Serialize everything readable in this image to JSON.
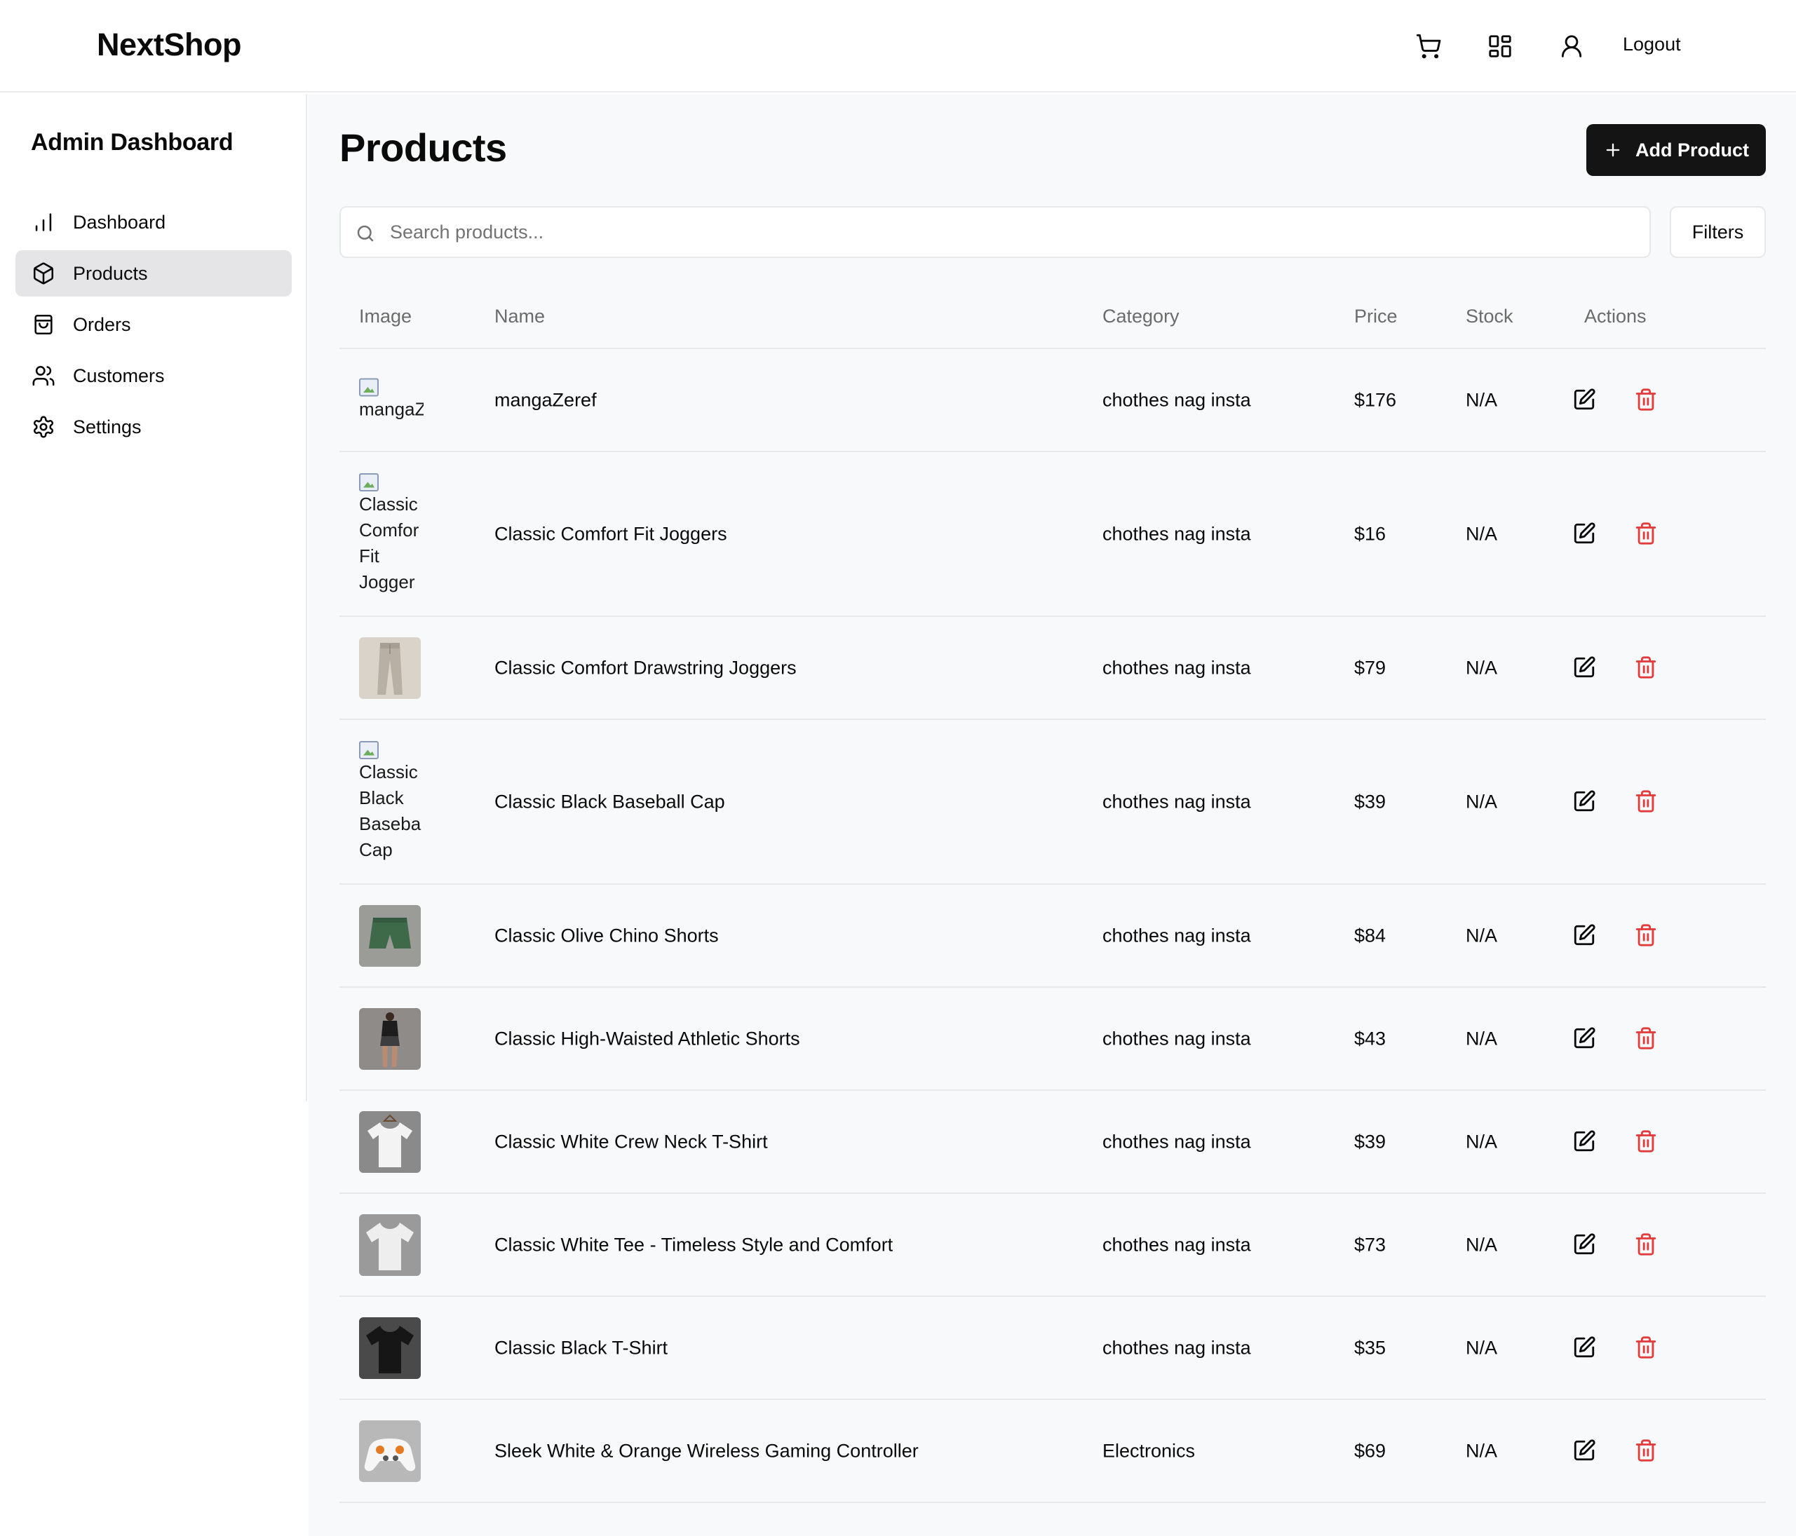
{
  "header": {
    "brand": "NextShop",
    "icons": [
      "cart-icon",
      "dashboard-grid-icon",
      "user-icon"
    ],
    "logout_label": "Logout"
  },
  "sidebar": {
    "title": "Admin Dashboard",
    "items": [
      {
        "label": "Dashboard",
        "icon": "bar-chart-icon",
        "active": false
      },
      {
        "label": "Products",
        "icon": "package-icon",
        "active": true
      },
      {
        "label": "Orders",
        "icon": "shopping-bag-icon",
        "active": false
      },
      {
        "label": "Customers",
        "icon": "users-icon",
        "active": false
      },
      {
        "label": "Settings",
        "icon": "gear-icon",
        "active": false
      }
    ]
  },
  "main": {
    "title": "Products",
    "add_button_label": "Add Product",
    "search_placeholder": "Search products...",
    "search_value": "",
    "filters_label": "Filters",
    "columns": [
      "Image",
      "Name",
      "Category",
      "Price",
      "Stock",
      "Actions"
    ],
    "rows": [
      {
        "image_alt": "mangaZ",
        "image_broken": true,
        "name": "mangaZeref",
        "category": "chothes nag insta",
        "price": "$176",
        "stock": "N/A"
      },
      {
        "image_alt": "Classic\nComfor\nFit\nJogger",
        "image_broken": true,
        "name": "Classic Comfort Fit Joggers",
        "category": "chothes nag insta",
        "price": "$16",
        "stock": "N/A"
      },
      {
        "image_alt": "",
        "image_broken": false,
        "thumb": "joggers-beige",
        "name": "Classic Comfort Drawstring Joggers",
        "category": "chothes nag insta",
        "price": "$79",
        "stock": "N/A"
      },
      {
        "image_alt": "Classic\nBlack\nBaseba\nCap",
        "image_broken": true,
        "name": "Classic Black Baseball Cap",
        "category": "chothes nag insta",
        "price": "$39",
        "stock": "N/A"
      },
      {
        "image_alt": "",
        "image_broken": false,
        "thumb": "shorts-olive",
        "name": "Classic Olive Chino Shorts",
        "category": "chothes nag insta",
        "price": "$84",
        "stock": "N/A"
      },
      {
        "image_alt": "",
        "image_broken": false,
        "thumb": "athletic-shorts",
        "name": "Classic High-Waisted Athletic Shorts",
        "category": "chothes nag insta",
        "price": "$43",
        "stock": "N/A"
      },
      {
        "image_alt": "",
        "image_broken": false,
        "thumb": "tshirt-white-hanger",
        "name": "Classic White Crew Neck T-Shirt",
        "category": "chothes nag insta",
        "price": "$39",
        "stock": "N/A"
      },
      {
        "image_alt": "",
        "image_broken": false,
        "thumb": "tshirt-white",
        "name": "Classic White Tee - Timeless Style and Comfort",
        "category": "chothes nag insta",
        "price": "$73",
        "stock": "N/A"
      },
      {
        "image_alt": "",
        "image_broken": false,
        "thumb": "tshirt-black",
        "name": "Classic Black T-Shirt",
        "category": "chothes nag insta",
        "price": "$35",
        "stock": "N/A"
      },
      {
        "image_alt": "",
        "image_broken": false,
        "thumb": "gaming-controller",
        "name": "Sleek White & Orange Wireless Gaming Controller",
        "category": "Electronics",
        "price": "$69",
        "stock": "N/A"
      }
    ],
    "row_actions": {
      "edit_icon": "edit-icon",
      "delete_icon": "trash-icon"
    }
  },
  "colors": {
    "primary_button": "#141414",
    "active_nav": "#e5e5e7",
    "delete": "#e23b3b",
    "main_bg": "#f8f9fa"
  }
}
